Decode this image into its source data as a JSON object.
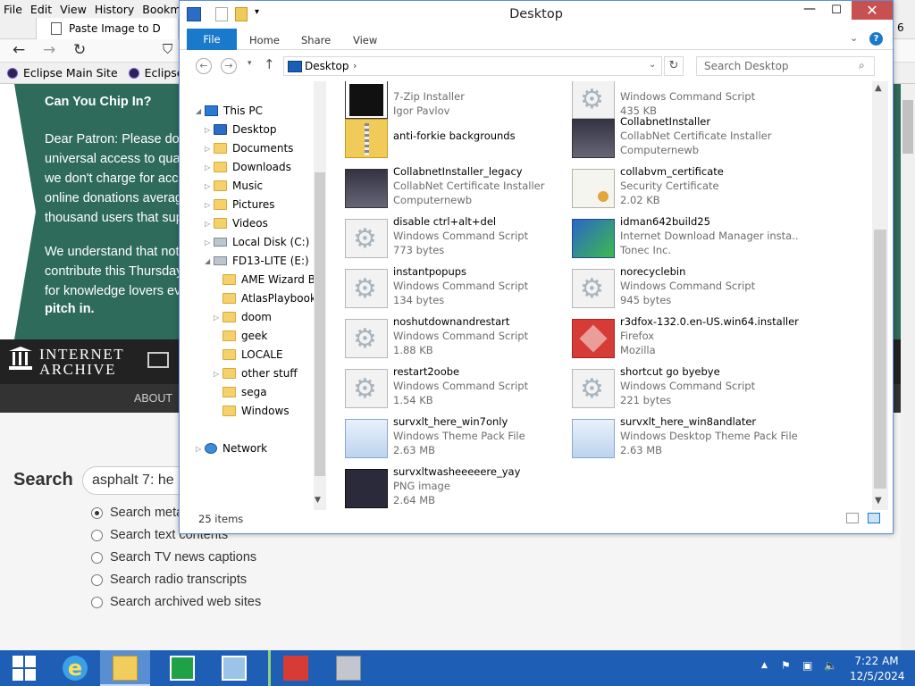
{
  "firefox": {
    "menu": [
      "File",
      "Edit",
      "View",
      "History",
      "Bookma"
    ],
    "tab_title": "Paste Image to D",
    "bookmarks": [
      "Eclipse Main Site",
      "Eclipse Co"
    ],
    "page": {
      "donate_title": "Can You Chip In?",
      "donate_lines": [
        "Dear Patron: Please don",
        "universal access to qua",
        "we don't charge for acce",
        "online donations averag",
        "thousand users that sup",
        "",
        "We understand that not",
        "contribute this Thursday",
        "for knowledge lovers ev",
        "pitch in."
      ],
      "ia_logo_top": "INTERNET",
      "ia_logo_bottom": "ARCHIVE",
      "about": "ABOUT",
      "search_label": "Search",
      "search_value": "asphalt 7: he",
      "options": [
        {
          "label": "Search metadata",
          "selected": true
        },
        {
          "label": "Search text contents",
          "selected": false
        },
        {
          "label": "Search TV news captions",
          "selected": false
        },
        {
          "label": "Search radio transcripts",
          "selected": false
        },
        {
          "label": "Search archived web sites",
          "selected": false
        }
      ],
      "side_number": "6"
    }
  },
  "explorer": {
    "title": "Desktop",
    "ribbon_tabs": [
      "File",
      "Home",
      "Share",
      "View"
    ],
    "address": "Desktop",
    "search_placeholder": "Search Desktop",
    "nav": [
      {
        "label": "This PC",
        "icon": "pc-icon",
        "level": 0,
        "expanded": true
      },
      {
        "label": "Desktop",
        "icon": "folder-icon",
        "level": 1
      },
      {
        "label": "Documents",
        "icon": "folder-icon",
        "level": 1
      },
      {
        "label": "Downloads",
        "icon": "folder-icon",
        "level": 1
      },
      {
        "label": "Music",
        "icon": "folder-icon",
        "level": 1
      },
      {
        "label": "Pictures",
        "icon": "folder-icon",
        "level": 1
      },
      {
        "label": "Videos",
        "icon": "folder-icon",
        "level": 1
      },
      {
        "label": "Local Disk (C:)",
        "icon": "drive-icon",
        "level": 1
      },
      {
        "label": "FD13-LITE (E:)",
        "icon": "drive-icon",
        "level": 1,
        "expanded": true
      },
      {
        "label": "AME Wizard Be",
        "icon": "folder-icon",
        "level": 2
      },
      {
        "label": "AtlasPlaybook_",
        "icon": "folder-icon",
        "level": 2
      },
      {
        "label": "doom",
        "icon": "folder-icon",
        "level": 2
      },
      {
        "label": "geek",
        "icon": "folder-icon",
        "level": 2
      },
      {
        "label": "LOCALE",
        "icon": "folder-icon",
        "level": 2
      },
      {
        "label": "other stuff",
        "icon": "folder-icon",
        "level": 2
      },
      {
        "label": "sega",
        "icon": "folder-icon",
        "level": 2
      },
      {
        "label": "Windows",
        "icon": "folder-icon",
        "level": 2
      },
      {
        "label": "Network",
        "icon": "network-icon",
        "level": 0
      }
    ],
    "files": [
      {
        "name": "",
        "type": "7-Zip Installer",
        "extra": "Igor Pavlov",
        "icon": "7zip"
      },
      {
        "name": "",
        "type": "Windows Command Script",
        "extra": "435 KB",
        "icon": "cmd"
      },
      {
        "name": "anti-forkie backgrounds",
        "type": "",
        "extra": "",
        "icon": "zip"
      },
      {
        "name": "CollabnetInstaller",
        "type": "CollabNet Certificate Installer",
        "extra": "Computernewb",
        "icon": "pc"
      },
      {
        "name": "CollabnetInstaller_legacy",
        "type": "CollabNet Certificate Installer",
        "extra": "Computernewb",
        "icon": "pc"
      },
      {
        "name": "collabvm_certificate",
        "type": "Security Certificate",
        "extra": "2.02 KB",
        "icon": "cert"
      },
      {
        "name": "disable ctrl+alt+del",
        "type": "Windows Command Script",
        "extra": "773 bytes",
        "icon": "cmd"
      },
      {
        "name": "idman642build25",
        "type": "Internet Download Manager insta...",
        "extra": "Tonec Inc.",
        "icon": "idm"
      },
      {
        "name": "instantpopups",
        "type": "Windows Command Script",
        "extra": "134 bytes",
        "icon": "cmd"
      },
      {
        "name": "norecyclebin",
        "type": "Windows Command Script",
        "extra": "945 bytes",
        "icon": "cmd"
      },
      {
        "name": "noshutdownandrestart",
        "type": "Windows Command Script",
        "extra": "1.88 KB",
        "icon": "cmd"
      },
      {
        "name": "r3dfox-132.0.en-US.win64.installer",
        "type": "Firefox",
        "extra": "Mozilla",
        "icon": "ff"
      },
      {
        "name": "restart2oobe",
        "type": "Windows Command Script",
        "extra": "1.54 KB",
        "icon": "cmd"
      },
      {
        "name": "shortcut go byebye",
        "type": "Windows Command Script",
        "extra": "221 bytes",
        "icon": "cmd"
      },
      {
        "name": "survxlt_here_win7only",
        "type": "Windows Theme Pack File",
        "extra": "2.63 MB",
        "icon": "theme"
      },
      {
        "name": "survxlt_here_win8andlater",
        "type": "Windows Desktop Theme Pack File",
        "extra": "2.63 MB",
        "icon": "theme"
      },
      {
        "name": "survxltwasheeeeere_yay",
        "type": "PNG image",
        "extra": "2.64 MB",
        "icon": "png"
      }
    ],
    "status_count": "25 items",
    "icons": {
      "cmd": "gear-script-icon",
      "zip": "zip-folder-icon"
    }
  },
  "taskbar": {
    "time": "7:22 AM",
    "date": "12/5/2024",
    "accent": "#1f5eb5"
  }
}
